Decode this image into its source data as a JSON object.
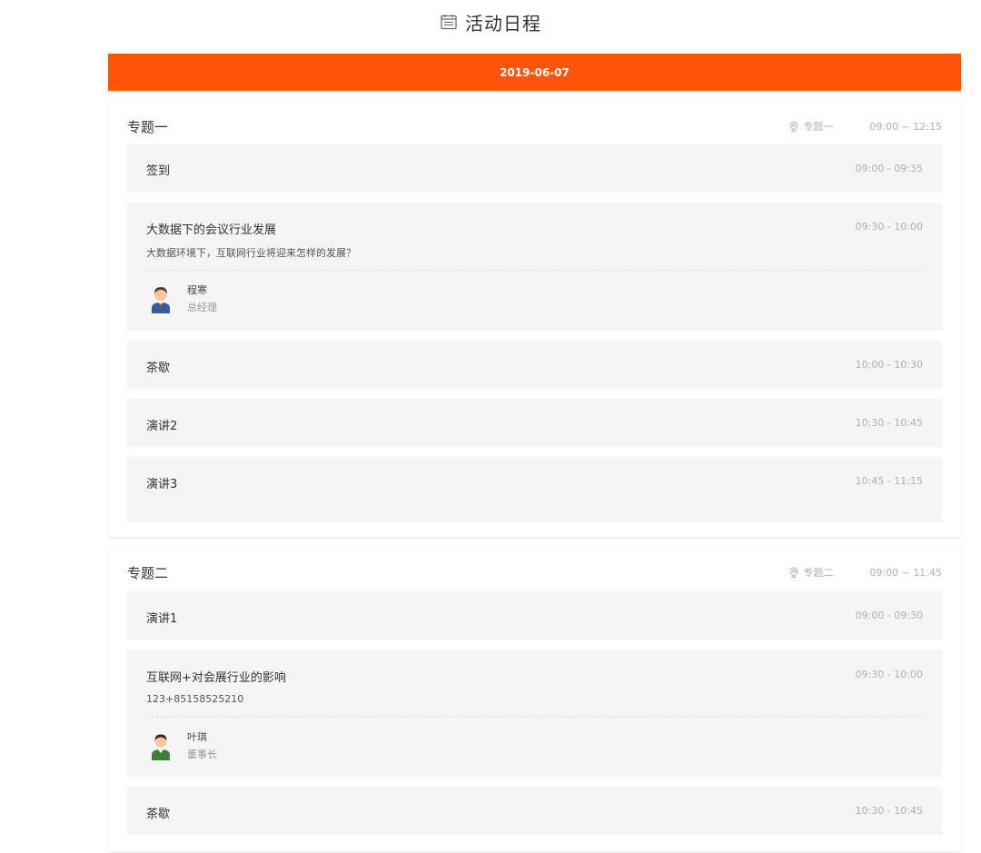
{
  "header": {
    "title": "活动日程",
    "icon": "calendar-icon"
  },
  "date": "2019-06-07",
  "colors": {
    "accent": "#ff5508",
    "item_bg": "#f5f5f5",
    "muted": "#b0b0b0"
  },
  "sessions": [
    {
      "title": "专题一",
      "location": "专题一",
      "time": "09:00 ~ 12:15",
      "items": [
        {
          "title": "签到",
          "time": "09:00 - 09:35"
        },
        {
          "title": "大数据下的会议行业发展",
          "time": "09:30 - 10:00",
          "desc": "大数据环境下，互联网行业将迎来怎样的发展？",
          "speaker": {
            "name": "程寒",
            "role": "总经理"
          }
        },
        {
          "title": "茶歇",
          "time": "10:00 - 10:30"
        },
        {
          "title": "演讲2",
          "time": "10:30 - 10:45"
        },
        {
          "title": "演讲3",
          "time": "10:45 - 11:15"
        }
      ]
    },
    {
      "title": "专题二",
      "location": "专题二",
      "time": "09:00 ~ 11:45",
      "items": [
        {
          "title": "演讲1",
          "time": "09:00 - 09:30"
        },
        {
          "title": "互联网+对会展行业的影响",
          "time": "09:30 - 10:00",
          "desc": "123+85158525210",
          "speaker": {
            "name": "叶琪",
            "role": "董事长"
          }
        },
        {
          "title": "茶歇",
          "time": "10:30 - 10:45"
        }
      ]
    }
  ]
}
